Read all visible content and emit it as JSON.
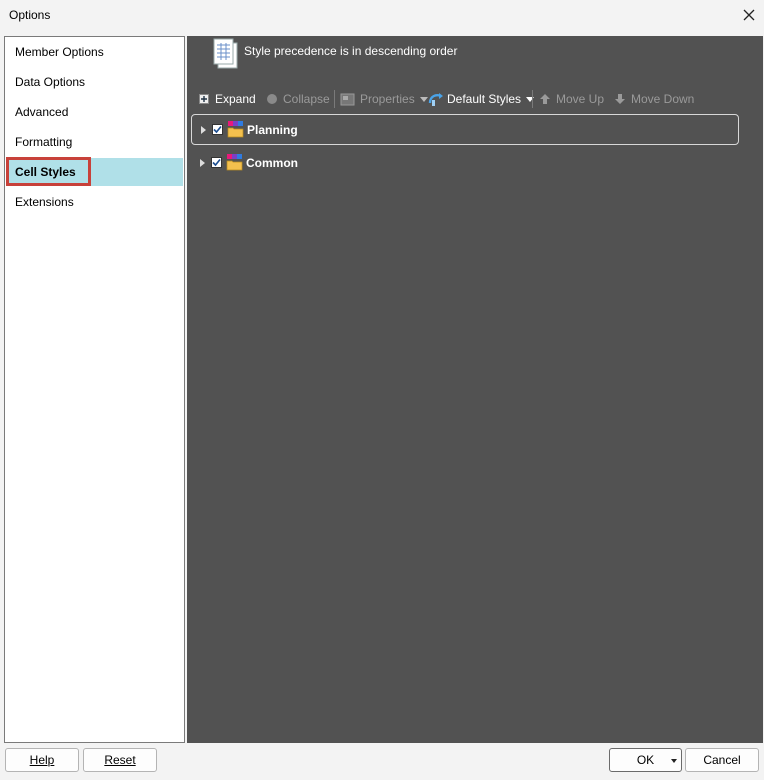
{
  "window": {
    "title": "Options"
  },
  "sidebar": {
    "items": [
      {
        "label": "Member Options",
        "selected": false
      },
      {
        "label": "Data Options",
        "selected": false
      },
      {
        "label": "Advanced",
        "selected": false
      },
      {
        "label": "Formatting",
        "selected": false
      },
      {
        "label": "Cell Styles",
        "selected": true
      },
      {
        "label": "Extensions",
        "selected": false
      }
    ]
  },
  "main": {
    "header_text": "Style precedence is in descending order",
    "toolbar": {
      "expand": "Expand",
      "collapse": "Collapse",
      "properties": "Properties",
      "default_styles": "Default Styles",
      "move_up": "Move Up",
      "move_down": "Move Down"
    },
    "tree": [
      {
        "label": "Planning",
        "checked": true,
        "selected": true
      },
      {
        "label": "Common",
        "checked": true,
        "selected": false
      }
    ]
  },
  "footer": {
    "help": "Help",
    "reset": "Reset",
    "ok": "OK",
    "cancel": "Cancel"
  },
  "colors": {
    "panel_bg": "#525252",
    "selected_item_bg": "#b0e0e8",
    "highlight_outline": "#c8413a"
  }
}
